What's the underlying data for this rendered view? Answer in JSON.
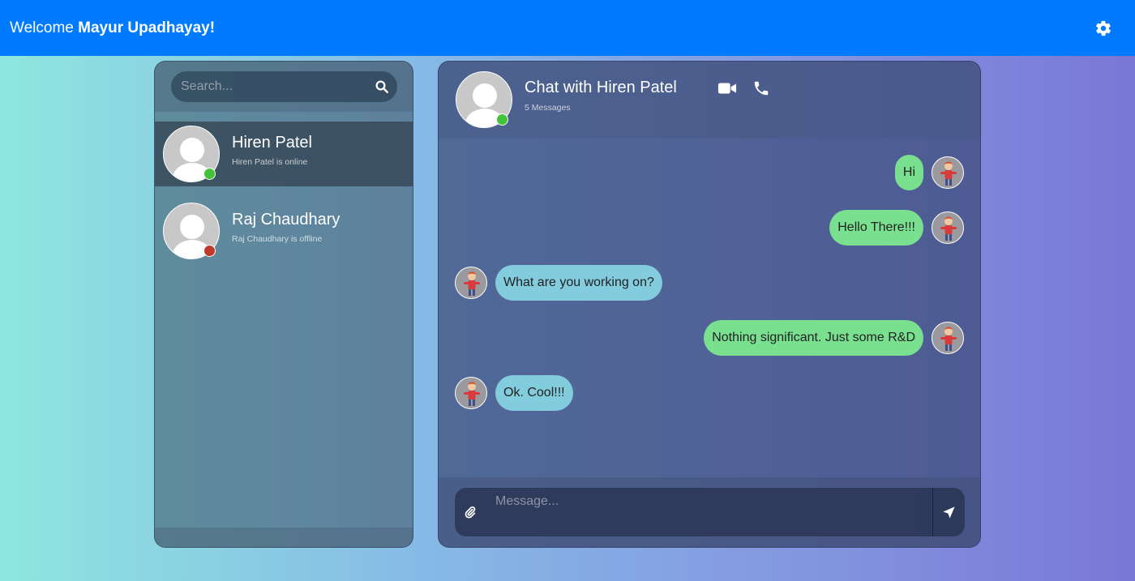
{
  "header": {
    "welcome_prefix": "Welcome",
    "user_name": "Mayur Upadhayay!",
    "settings_icon": "gear-icon"
  },
  "search": {
    "placeholder": "Search...",
    "icon": "search-icon"
  },
  "contacts": [
    {
      "name": "Hiren Patel",
      "status_text": "Hiren Patel is online",
      "status": "online",
      "active": true
    },
    {
      "name": "Raj Chaudhary",
      "status_text": "Raj Chaudhary is offline",
      "status": "offline",
      "active": false
    }
  ],
  "chat": {
    "title": "Chat with Hiren Patel",
    "message_count": "5 Messages",
    "contact_status": "online",
    "actions": [
      "video-camera-icon",
      "phone-icon"
    ],
    "messages": [
      {
        "text": "Hi",
        "direction": "sent"
      },
      {
        "text": "Hello There!!!",
        "direction": "sent"
      },
      {
        "text": "What are you working on?",
        "direction": "received"
      },
      {
        "text": "Nothing significant. Just some R&D",
        "direction": "sent"
      },
      {
        "text": "Ok. Cool!!!",
        "direction": "received"
      }
    ]
  },
  "composer": {
    "placeholder": "Message...",
    "attach_icon": "paperclip-icon",
    "send_icon": "send-icon"
  },
  "colors": {
    "topbar": "#007bff",
    "online": "#44c23a",
    "offline": "#c0392b",
    "sent_bubble": "#78e08f",
    "received_bubble": "#82ccdd"
  }
}
